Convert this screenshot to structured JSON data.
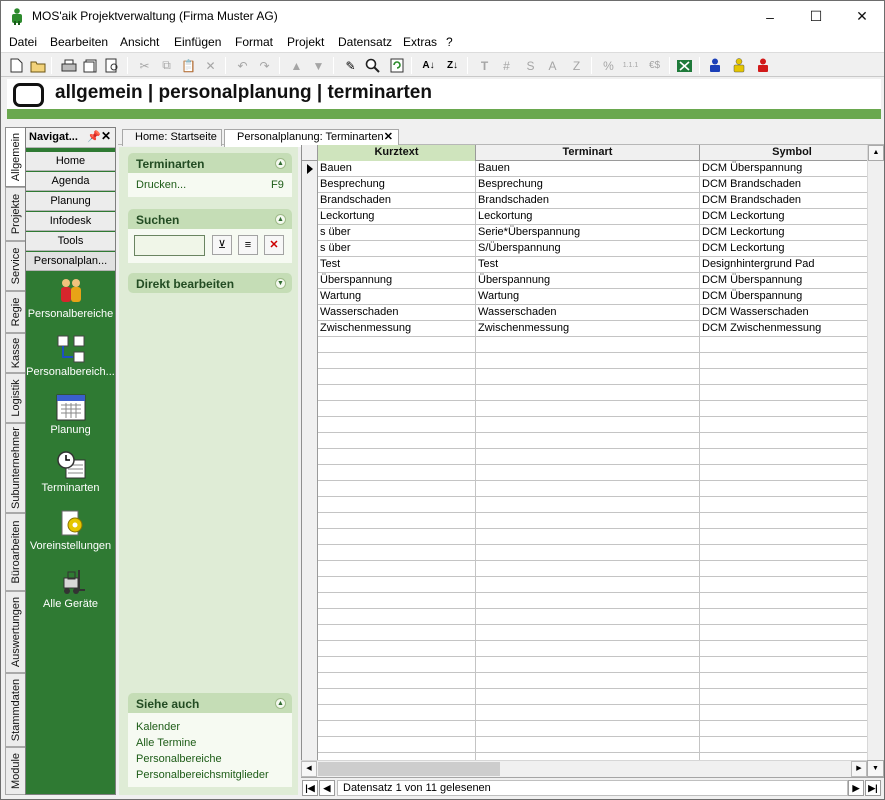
{
  "window": {
    "title": "MOS'aik Projektverwaltung (Firma Muster AG)",
    "minimize": "–",
    "maximize": "☐",
    "close": "✕"
  },
  "menu": [
    "Datei",
    "Bearbeiten",
    "Ansicht",
    "Einfügen",
    "Format",
    "Projekt",
    "Datensatz",
    "Extras",
    "?"
  ],
  "breadcrumb": "allgemein | personalplanung | terminarten",
  "vertical_tabs": [
    "Allgemein",
    "Projekte",
    "Service",
    "Regie",
    "Kasse",
    "Logistik",
    "Subunternehmer",
    "Büroarbeiten",
    "Auswertungen",
    "Stammdaten",
    "Module"
  ],
  "nav": {
    "title": "Navigat...",
    "pin": "📌",
    "close": "✕",
    "buttons": [
      "Home",
      "Agenda",
      "Planung",
      "Infodesk",
      "Tools",
      "Personalplan..."
    ],
    "items": [
      {
        "label": "Personalbereiche",
        "icon": "people-icon"
      },
      {
        "label": "Personalbereich...",
        "icon": "member-assign-icon"
      },
      {
        "label": "Planung",
        "icon": "calendar-icon"
      },
      {
        "label": "Terminarten",
        "icon": "clock-calendar-icon"
      },
      {
        "label": "Voreinstellungen",
        "icon": "settings-icon"
      },
      {
        "label": "Alle Geräte",
        "icon": "forklift-icon"
      }
    ]
  },
  "task": {
    "sections": [
      {
        "title": "Terminarten",
        "links": [
          {
            "label": "Drucken...",
            "shortcut": "F9"
          }
        ]
      },
      {
        "title": "Suchen"
      },
      {
        "title": "Direkt bearbeiten"
      },
      {
        "title": "Siehe auch",
        "links": [
          {
            "label": "Kalender"
          },
          {
            "label": "Alle Termine"
          },
          {
            "label": "Personalbereiche"
          },
          {
            "label": "Personalbereichsmitglieder"
          }
        ]
      }
    ],
    "search_value": ""
  },
  "doc_tabs": [
    {
      "label": "Home: Startseite",
      "active": false
    },
    {
      "label": "Personalplanung: Terminarten",
      "active": true,
      "close": "✕"
    }
  ],
  "grid": {
    "columns": [
      "Kurztext",
      "Terminart",
      "Symbol"
    ],
    "rows": [
      [
        "Bauen",
        "Bauen",
        "DCM Überspannung"
      ],
      [
        "Besprechung",
        "Besprechung",
        "DCM Brandschaden"
      ],
      [
        "Brandschaden",
        "Brandschaden",
        "DCM Brandschaden"
      ],
      [
        "Leckortung",
        "Leckortung",
        "DCM Leckortung"
      ],
      [
        "s über",
        "Serie*Überspannung",
        "DCM Leckortung"
      ],
      [
        "s über",
        "S/Überspannung",
        "DCM Leckortung"
      ],
      [
        "Test",
        "Test",
        "Designhintergrund Pad"
      ],
      [
        "Überspannung",
        "Überspannung",
        "DCM Überspannung"
      ],
      [
        "Wartung",
        "Wartung",
        "DCM Überspannung"
      ],
      [
        "Wasserschaden",
        "Wasserschaden",
        "DCM Wasserschaden"
      ],
      [
        "Zwischenmessung",
        "Zwischenmessung",
        "DCM Zwischenmessung"
      ]
    ]
  },
  "navigator": {
    "status": "Datensatz 1 von 11 gelesenen",
    "first": "|◀",
    "prev": "◀",
    "next": "▶",
    "last": "▶|"
  },
  "colors": {
    "green_bar": "#6aa84f",
    "nav_green": "#2f7a33",
    "task_bg": "#dfecd6",
    "accent_header": "#cfe4bd"
  }
}
